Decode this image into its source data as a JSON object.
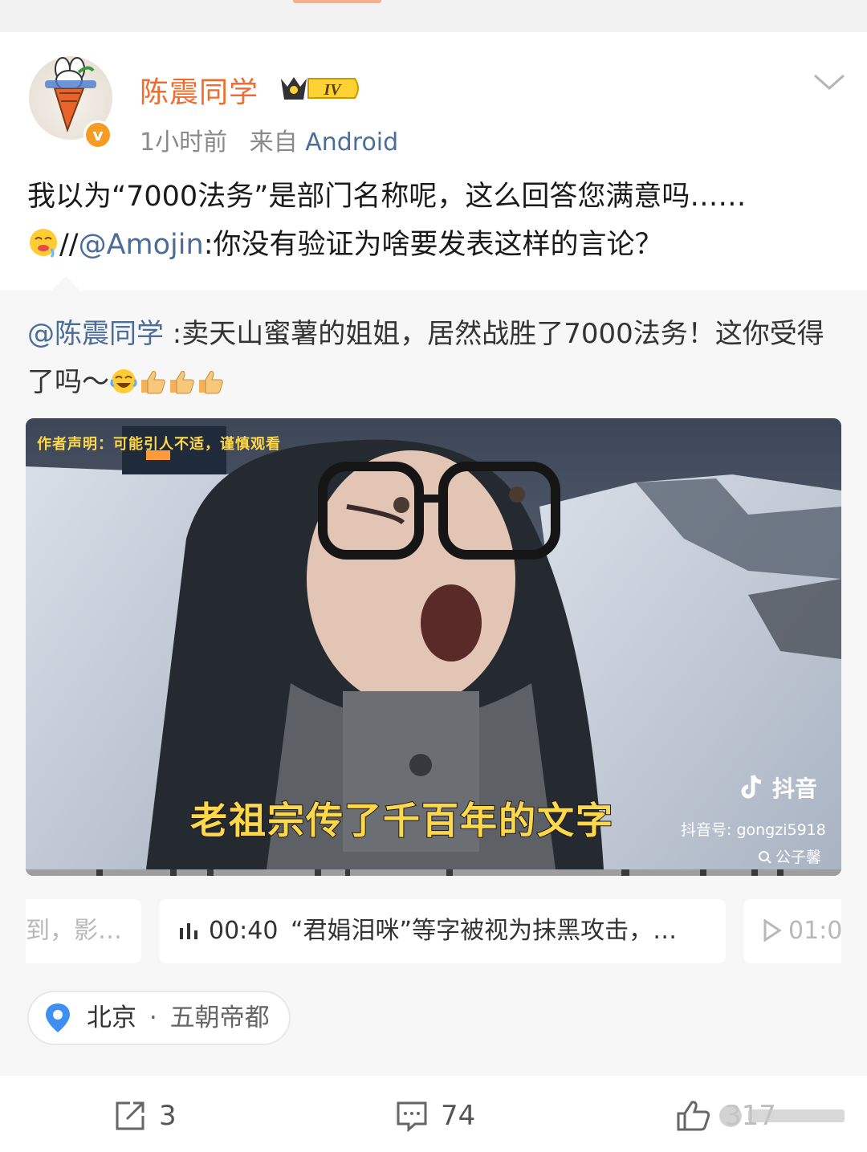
{
  "post": {
    "author": "陈震同学",
    "vip_level": "IV",
    "verified_mark": "v",
    "time": "1小时前",
    "source_prefix": "来自",
    "source": "Android",
    "text_line1": "我以为“7000法务”是部门名称呢，这么回答您满意吗……",
    "text_sep": "//",
    "text_mention": "@Amojin",
    "text_rest": ":你没有验证为啥要发表这样的言论？"
  },
  "repost": {
    "mention": "@陈震同学",
    "text": " :卖天山蜜薯的姐姐，居然战胜了7000法务！这你受得了吗～"
  },
  "video": {
    "top_note": "作者声明：可能引人不适，谨慎观看",
    "subtitle": "老祖宗传了千百年的文字",
    "platform_logo": "抖音",
    "platform_id": "抖音号: gongzi5918",
    "platform_search": "公子馨"
  },
  "chapters": [
    {
      "label": "到，影…"
    },
    {
      "time": "00:40",
      "label": "“君娟泪咪”等字被视为抹黑攻击，…"
    },
    {
      "time": "01:0"
    }
  ],
  "location": {
    "city": "北京",
    "sep": "·",
    "name": "五朝帝都"
  },
  "actions": {
    "reposts": "3",
    "comments": "74",
    "likes": "317"
  },
  "colors": {
    "username": "#f26b2a",
    "link": "#4a6d9a",
    "subtitle": "#ffd84a",
    "verified": "#f79b22"
  },
  "icons": [
    "avatar-illustration",
    "verified-icon",
    "vip-crown-icon",
    "chevron-down-icon",
    "emoji-drooling-icon",
    "emoji-laugh-cry-icon",
    "thumbs-up-emoji-icon",
    "douyin-icon",
    "search-icon",
    "audio-bars-icon",
    "play-icon",
    "location-pin-icon",
    "repost-icon",
    "comment-icon",
    "like-icon"
  ]
}
